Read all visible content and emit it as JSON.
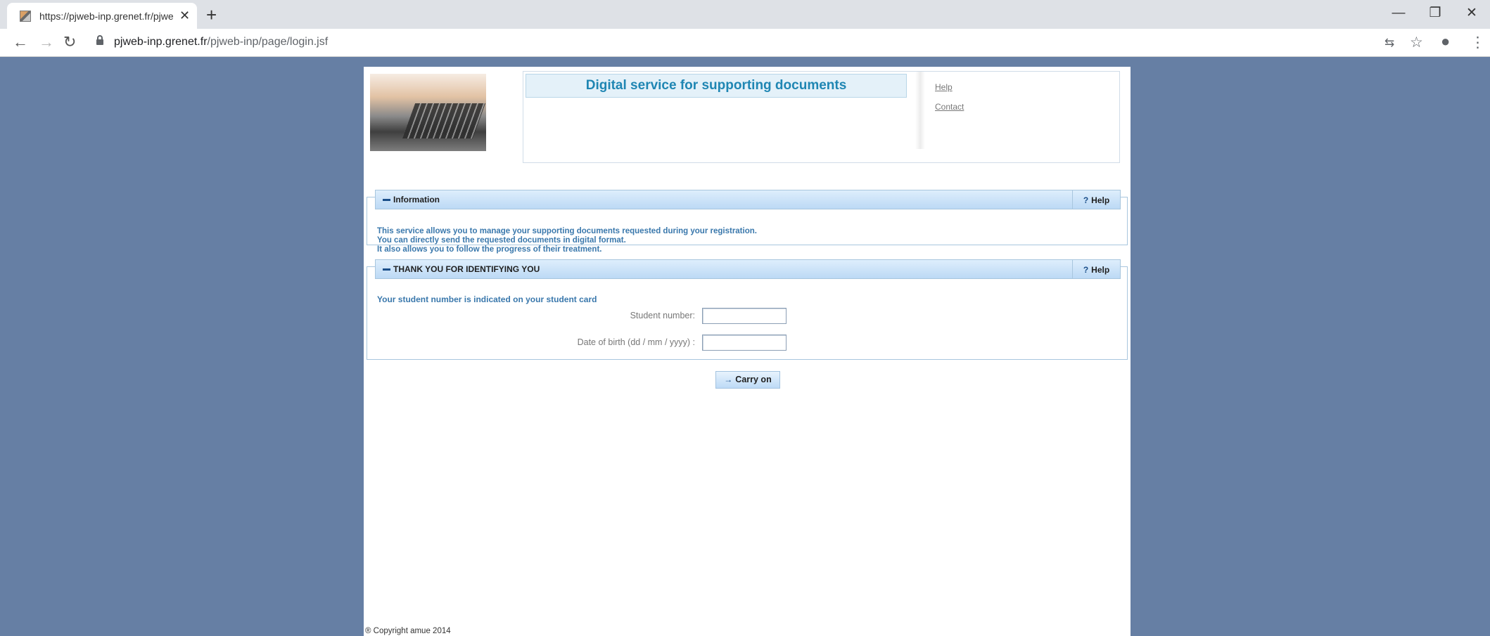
{
  "browser": {
    "tab_title": "https://pjweb-inp.grenet.fr/pjwe",
    "tab_close": "✕",
    "new_tab": "+",
    "url_host": "pjweb-inp.grenet.fr",
    "url_path": "/pjweb-inp/page/login.jsf",
    "nav": {
      "back": "←",
      "forward": "→",
      "reload": "↻"
    },
    "tools": {
      "translate": "⇆",
      "star": "☆",
      "profile": "●",
      "menu": "⋮"
    },
    "window": {
      "minimize": "—",
      "restore": "❐",
      "close": "✕"
    }
  },
  "header": {
    "title": "Digital service for supporting documents",
    "links": [
      "Help",
      "Contact"
    ]
  },
  "information": {
    "title": "Information",
    "help_label": "Help",
    "help_glyph": "?",
    "lines": [
      "This service allows you to manage your supporting documents requested during your registration.",
      "You can directly send the requested documents in digital format.",
      "It also allows you to follow the progress of their treatment."
    ]
  },
  "identification": {
    "title": "THANK YOU FOR IDENTIFYING YOU",
    "help_label": "Help",
    "help_glyph": "?",
    "hint": "Your student number is indicated on your student card",
    "student_number_label": "Student number:",
    "student_number_value": "",
    "dob_label": "Date of birth (dd / mm / yyyy) :",
    "dob_value": ""
  },
  "carry_on": {
    "label": "Carry on",
    "glyph": "→"
  },
  "footer": {
    "copyright": "® Copyright amue 2014"
  },
  "colors": {
    "background": "#667fa4",
    "title_text": "#1f86b3",
    "info_text": "#3a78ac",
    "section_head": "#bcd9f5"
  }
}
